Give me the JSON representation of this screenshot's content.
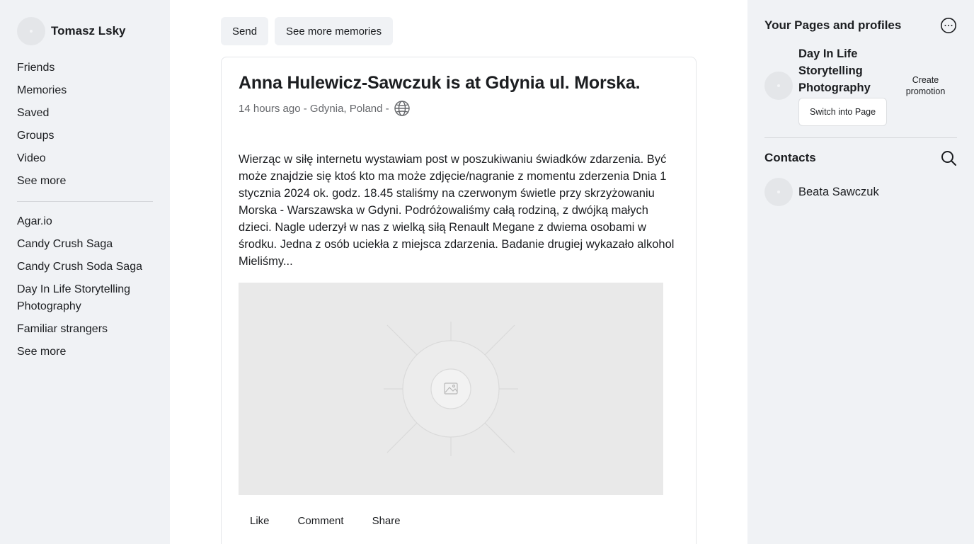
{
  "left_sidebar": {
    "profile_name": "Tomasz Lsky",
    "nav": [
      "Friends",
      "Memories",
      "Saved",
      "Groups",
      "Video",
      "See more"
    ],
    "shortcuts": [
      "Agar.io",
      "Candy Crush Saga",
      "Candy Crush Soda Saga",
      "Day In Life Storytelling Photography",
      "Familiar strangers",
      "See more"
    ]
  },
  "top_actions": {
    "send_label": "Send",
    "memories_label": "See more memories"
  },
  "post": {
    "title": "Anna Hulewicz-Sawczuk is at Gdynia ul. Morska.",
    "meta": "14 hours ago - Gdynia, Poland -",
    "privacy_icon": "globe-icon",
    "text": "Wierząc w siłę internetu wystawiam post w poszukiwaniu świadków zdarzenia. Być może znajdzie się ktoś kto ma może zdjęcie/nagranie z momentu zderzenia Dnia 1 stycznia 2024 ok. godz. 18.45 staliśmy na czerwonym świetle przy skrzyżowaniu Morska - Warszawska w Gdyni. Podróżowaliśmy całą rodziną, z dwójką małych dzieci. Nagle uderzył w nas z wielką siłą Renault Megane z dwiema osobami w środku. Jedna z osób uciekła z miejsca zdarzenia. Badanie drugiej wykazało alkohol",
    "text_more": "Mieliśmy...",
    "actions": {
      "like": "Like",
      "comment": "Comment",
      "share": "Share"
    }
  },
  "right_sidebar": {
    "pages_title": "Your Pages and profiles",
    "page_name": "Day In Life Storytelling Photography",
    "switch_label": "Switch into Page",
    "create_promo_label": "Create promotion",
    "contacts_title": "Contacts",
    "contacts": [
      "Beata Sawczuk"
    ]
  },
  "colors": {
    "sidebar_bg": "#f0f2f5",
    "text": "#1c1e21",
    "muted": "#65676b",
    "image_placeholder": "#e9e9e9"
  }
}
